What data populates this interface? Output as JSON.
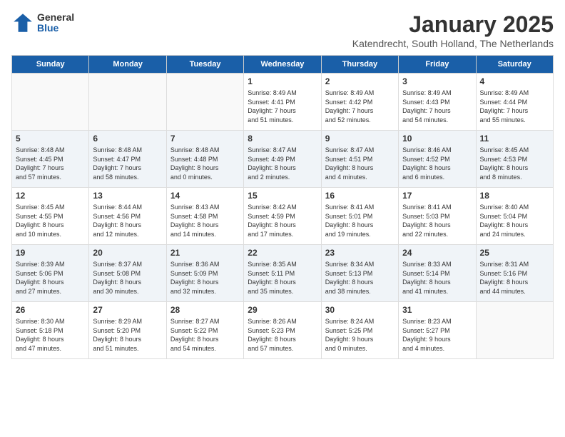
{
  "logo": {
    "general": "General",
    "blue": "Blue"
  },
  "title": "January 2025",
  "subtitle": "Katendrecht, South Holland, The Netherlands",
  "days_header": [
    "Sunday",
    "Monday",
    "Tuesday",
    "Wednesday",
    "Thursday",
    "Friday",
    "Saturday"
  ],
  "weeks": [
    [
      {
        "day": "",
        "info": ""
      },
      {
        "day": "",
        "info": ""
      },
      {
        "day": "",
        "info": ""
      },
      {
        "day": "1",
        "info": "Sunrise: 8:49 AM\nSunset: 4:41 PM\nDaylight: 7 hours\nand 51 minutes."
      },
      {
        "day": "2",
        "info": "Sunrise: 8:49 AM\nSunset: 4:42 PM\nDaylight: 7 hours\nand 52 minutes."
      },
      {
        "day": "3",
        "info": "Sunrise: 8:49 AM\nSunset: 4:43 PM\nDaylight: 7 hours\nand 54 minutes."
      },
      {
        "day": "4",
        "info": "Sunrise: 8:49 AM\nSunset: 4:44 PM\nDaylight: 7 hours\nand 55 minutes."
      }
    ],
    [
      {
        "day": "5",
        "info": "Sunrise: 8:48 AM\nSunset: 4:45 PM\nDaylight: 7 hours\nand 57 minutes."
      },
      {
        "day": "6",
        "info": "Sunrise: 8:48 AM\nSunset: 4:47 PM\nDaylight: 7 hours\nand 58 minutes."
      },
      {
        "day": "7",
        "info": "Sunrise: 8:48 AM\nSunset: 4:48 PM\nDaylight: 8 hours\nand 0 minutes."
      },
      {
        "day": "8",
        "info": "Sunrise: 8:47 AM\nSunset: 4:49 PM\nDaylight: 8 hours\nand 2 minutes."
      },
      {
        "day": "9",
        "info": "Sunrise: 8:47 AM\nSunset: 4:51 PM\nDaylight: 8 hours\nand 4 minutes."
      },
      {
        "day": "10",
        "info": "Sunrise: 8:46 AM\nSunset: 4:52 PM\nDaylight: 8 hours\nand 6 minutes."
      },
      {
        "day": "11",
        "info": "Sunrise: 8:45 AM\nSunset: 4:53 PM\nDaylight: 8 hours\nand 8 minutes."
      }
    ],
    [
      {
        "day": "12",
        "info": "Sunrise: 8:45 AM\nSunset: 4:55 PM\nDaylight: 8 hours\nand 10 minutes."
      },
      {
        "day": "13",
        "info": "Sunrise: 8:44 AM\nSunset: 4:56 PM\nDaylight: 8 hours\nand 12 minutes."
      },
      {
        "day": "14",
        "info": "Sunrise: 8:43 AM\nSunset: 4:58 PM\nDaylight: 8 hours\nand 14 minutes."
      },
      {
        "day": "15",
        "info": "Sunrise: 8:42 AM\nSunset: 4:59 PM\nDaylight: 8 hours\nand 17 minutes."
      },
      {
        "day": "16",
        "info": "Sunrise: 8:41 AM\nSunset: 5:01 PM\nDaylight: 8 hours\nand 19 minutes."
      },
      {
        "day": "17",
        "info": "Sunrise: 8:41 AM\nSunset: 5:03 PM\nDaylight: 8 hours\nand 22 minutes."
      },
      {
        "day": "18",
        "info": "Sunrise: 8:40 AM\nSunset: 5:04 PM\nDaylight: 8 hours\nand 24 minutes."
      }
    ],
    [
      {
        "day": "19",
        "info": "Sunrise: 8:39 AM\nSunset: 5:06 PM\nDaylight: 8 hours\nand 27 minutes."
      },
      {
        "day": "20",
        "info": "Sunrise: 8:37 AM\nSunset: 5:08 PM\nDaylight: 8 hours\nand 30 minutes."
      },
      {
        "day": "21",
        "info": "Sunrise: 8:36 AM\nSunset: 5:09 PM\nDaylight: 8 hours\nand 32 minutes."
      },
      {
        "day": "22",
        "info": "Sunrise: 8:35 AM\nSunset: 5:11 PM\nDaylight: 8 hours\nand 35 minutes."
      },
      {
        "day": "23",
        "info": "Sunrise: 8:34 AM\nSunset: 5:13 PM\nDaylight: 8 hours\nand 38 minutes."
      },
      {
        "day": "24",
        "info": "Sunrise: 8:33 AM\nSunset: 5:14 PM\nDaylight: 8 hours\nand 41 minutes."
      },
      {
        "day": "25",
        "info": "Sunrise: 8:31 AM\nSunset: 5:16 PM\nDaylight: 8 hours\nand 44 minutes."
      }
    ],
    [
      {
        "day": "26",
        "info": "Sunrise: 8:30 AM\nSunset: 5:18 PM\nDaylight: 8 hours\nand 47 minutes."
      },
      {
        "day": "27",
        "info": "Sunrise: 8:29 AM\nSunset: 5:20 PM\nDaylight: 8 hours\nand 51 minutes."
      },
      {
        "day": "28",
        "info": "Sunrise: 8:27 AM\nSunset: 5:22 PM\nDaylight: 8 hours\nand 54 minutes."
      },
      {
        "day": "29",
        "info": "Sunrise: 8:26 AM\nSunset: 5:23 PM\nDaylight: 8 hours\nand 57 minutes."
      },
      {
        "day": "30",
        "info": "Sunrise: 8:24 AM\nSunset: 5:25 PM\nDaylight: 9 hours\nand 0 minutes."
      },
      {
        "day": "31",
        "info": "Sunrise: 8:23 AM\nSunset: 5:27 PM\nDaylight: 9 hours\nand 4 minutes."
      },
      {
        "day": "",
        "info": ""
      }
    ]
  ]
}
